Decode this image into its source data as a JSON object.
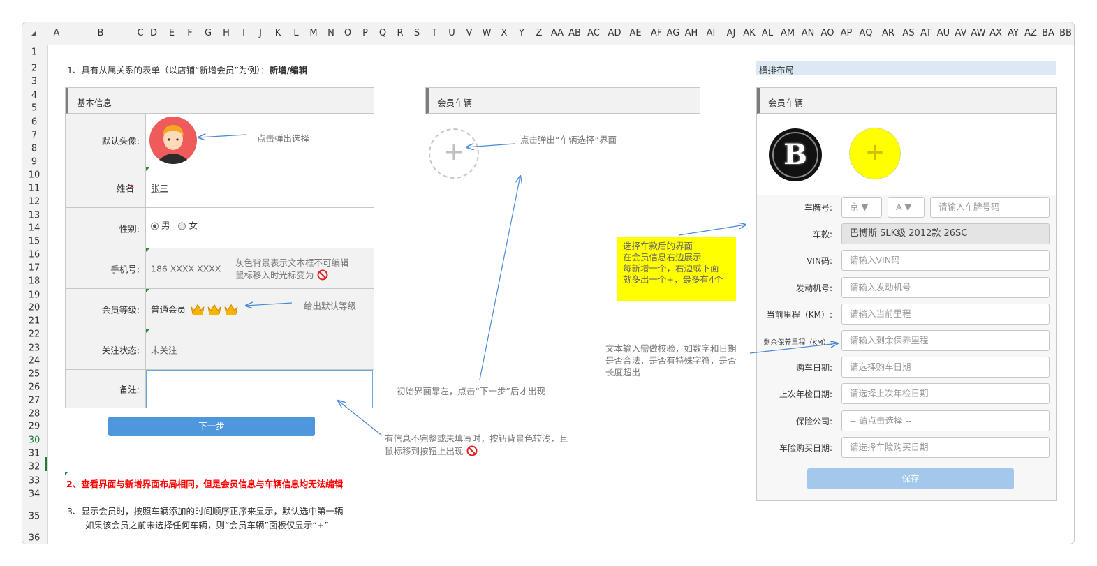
{
  "columns": [
    "A",
    "B",
    "C",
    "D",
    "E",
    "F",
    "G",
    "H",
    "I",
    "J",
    "K",
    "L",
    "M",
    "N",
    "O",
    "P",
    "Q",
    "R",
    "S",
    "T",
    "U",
    "V",
    "W",
    "X",
    "Y",
    "Z",
    "AA",
    "AB",
    "AC",
    "AD",
    "AE",
    "AF",
    "AG",
    "AH",
    "AI",
    "AJ",
    "AK",
    "AL",
    "AM",
    "AN",
    "AO",
    "AP",
    "AQ",
    "AR",
    "AS",
    "AT",
    "AU",
    "AV",
    "AW",
    "AX",
    "AY",
    "AZ",
    "BA",
    "BB"
  ],
  "rows": [
    "1",
    "2",
    "3",
    "4",
    "5",
    "6",
    "7",
    "8",
    "9",
    "10",
    "11",
    "12",
    "13",
    "14",
    "15",
    "16",
    "17",
    "18",
    "19",
    "20",
    "21",
    "22",
    "23",
    "24",
    "25",
    "26",
    "27",
    "28",
    "29",
    "30",
    "31",
    "32",
    "33",
    "34",
    "35",
    "36"
  ],
  "active_row": "30",
  "heading1": "1、具有从属关系的表单（以店铺“新增会员”为例）：",
  "heading1_bold": "新增/编辑",
  "layout_tag": "横排布局",
  "basic_panel": {
    "title": "基本信息",
    "avatar_label": "默认头像:",
    "name_label": "姓名",
    "name_req": "*",
    "name_colon": ":",
    "name_value": "张三",
    "gender_label": "性别:",
    "gender_male": "男",
    "gender_female": "女",
    "phone_label": "手机号:",
    "phone_value": "186 XXXX XXXX",
    "level_label": "会员等级:",
    "level_value": "普通会员",
    "follow_label": "关注状态:",
    "follow_value": "未关注",
    "remark_label": "备注:",
    "next_button": "下一步"
  },
  "vehicle_panel_left": {
    "title": "会员车辆",
    "add_symbol": "+"
  },
  "vehicle_panel_right": {
    "title": "会员车辆",
    "brand_logo": "B",
    "add_symbol": "+",
    "plate_label": "车牌号:",
    "plate_province": "京 ▼",
    "plate_letter": "A ▼",
    "plate_placeholder": "请输入车牌号码",
    "model_label": "车款:",
    "model_value": "巴博斯 SLK级 2012款 26SC",
    "vin_label": "VIN码:",
    "vin_placeholder": "请输入VIN码",
    "engine_label": "发动机号:",
    "engine_placeholder": "请输入发动机号",
    "mileage_label": "当前里程（KM）:",
    "mileage_placeholder": "请输入当前里程",
    "remain_label": "剩余保养里程（KM）:",
    "remain_placeholder": "请输入剩余保养里程",
    "buy_date_label": "购车日期:",
    "buy_date_placeholder": "请选择购车日期",
    "inspect_label": "上次年检日期:",
    "inspect_placeholder": "请选择上次年检日期",
    "insurer_label": "保险公司:",
    "insurer_placeholder": "-- 请点击选择 --",
    "ins_date_label": "车险购买日期:",
    "ins_date_placeholder": "请选择车险购买日期",
    "save_button": "保存"
  },
  "notes": {
    "avatar": "点击弹出选择",
    "vehicle_add": "点击弹出“车辆选择”界面",
    "readonly1": "灰色背景表示文本框不可编辑",
    "readonly2": "鼠标移入时光标变为",
    "level": "给出默认等级",
    "initial": "初始界面靠左，点击“下一步”后才出现",
    "incomplete1": "有信息不完整或未填写时，按钮背景色较浅，且",
    "incomplete2": "鼠标移到按钮上出现",
    "yellow1": "选择车款后的界面",
    "yellow2": "在会员信息右边展示",
    "yellow3": "每新增一个，右边或下面",
    "yellow4": "就多出一个+，最多有4个",
    "validate1": "文本输入需做校验，如数字和日期",
    "validate2": "是否合法，是否有特殊字符，是否",
    "validate3": "长度超出"
  },
  "footer": {
    "line2": "2、查看界面与新增界面布局相同，但是会员信息与车辆信息均无法编辑",
    "line3a": "3、显示会员时，按照车辆添加的时间顺序正序来显示，默认选中第一辆",
    "line3b": "如果该会员之前未选择任何车辆，则“会员车辆”面板仅显示“+”"
  },
  "colors": {
    "button_blue": "#4f97dd",
    "button_light_blue": "#a3c8ec",
    "note_yellow": "#ffff00",
    "tag_blue": "#dce8f4",
    "required_red": "#e02020",
    "arrow_blue": "#4a8ad4",
    "footer_red": "#ff0000"
  }
}
